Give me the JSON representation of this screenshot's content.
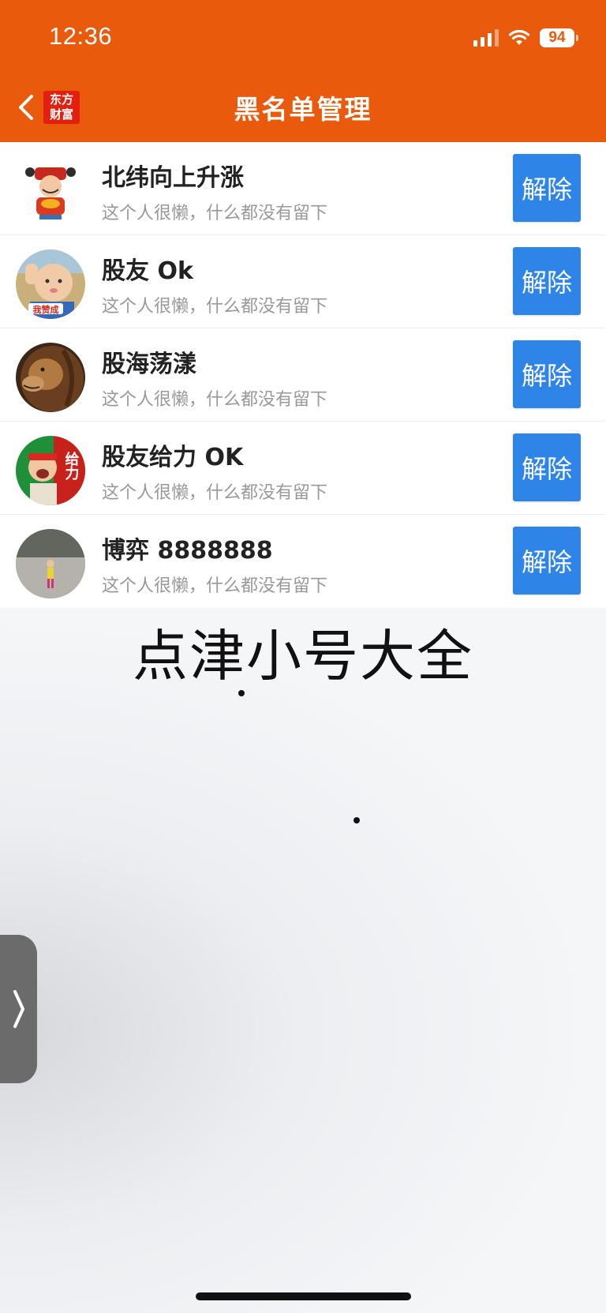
{
  "status_bar": {
    "time": "12:36",
    "battery": "94"
  },
  "header": {
    "logo_line1": "东方",
    "logo_line2": "财富",
    "title": "黑名单管理"
  },
  "blacklist": [
    {
      "name": "北纬向上升涨",
      "signature": "这个人很懒，什么都没有留下",
      "action": "解除"
    },
    {
      "name": "股友 Ok",
      "signature": "这个人很懒，什么都没有留下",
      "action": "解除"
    },
    {
      "name": "股海荡漾",
      "signature": "这个人很懒，什么都没有留下",
      "action": "解除"
    },
    {
      "name": "股友给力 OK",
      "signature": "这个人很懒，什么都没有留下",
      "action": "解除"
    },
    {
      "name": "博弈 8888888",
      "signature": "这个人很懒，什么都没有留下",
      "action": "解除"
    }
  ],
  "avatar_badges": {
    "baby": "我赞成",
    "geili": "给力"
  },
  "watermark": "点津小号大全",
  "colors": {
    "header": "#ea5a0c",
    "button": "#2f84e8",
    "logo": "#e3200f"
  }
}
